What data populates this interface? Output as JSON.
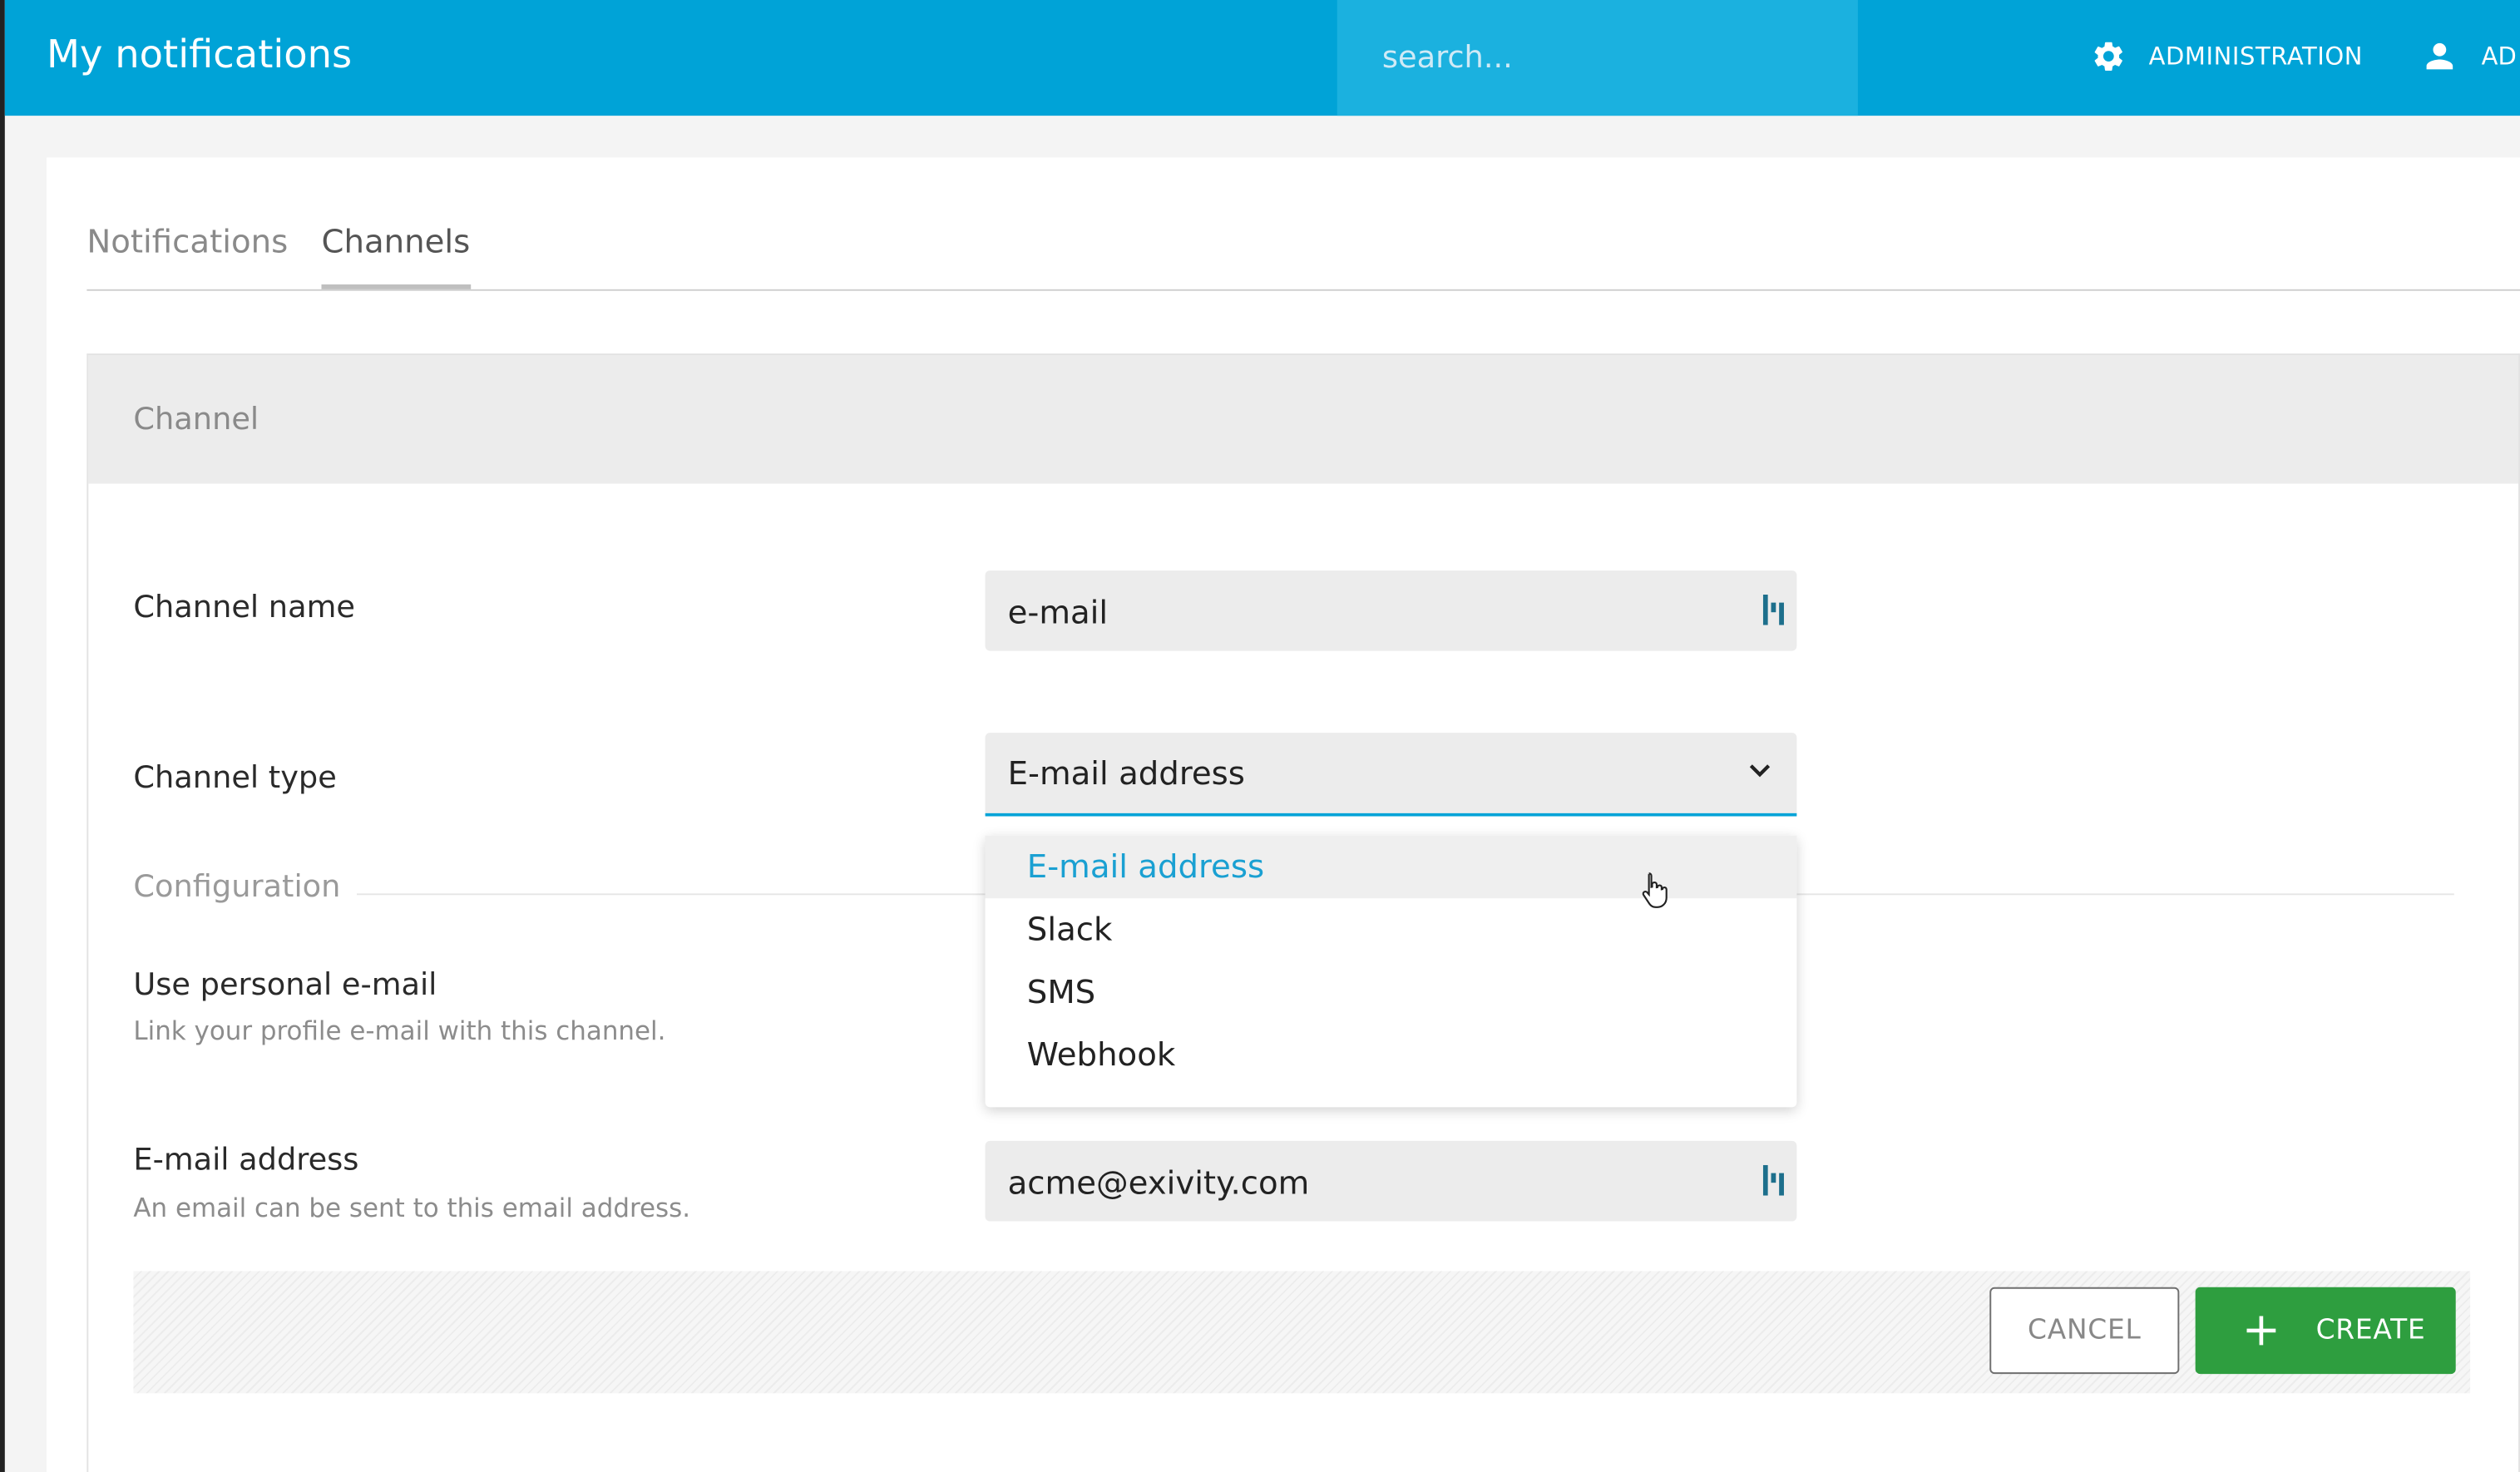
{
  "header": {
    "title": "My notifications",
    "search_placeholder": "search...",
    "admin_label": "ADMINISTRATION",
    "user_label": "AD"
  },
  "tabs": [
    {
      "label": "Notifications",
      "active": false
    },
    {
      "label": "Channels",
      "active": true
    }
  ],
  "panel": {
    "title": "Channel",
    "channel_name": {
      "label": "Channel name",
      "value": "e-mail"
    },
    "channel_type": {
      "label": "Channel type",
      "selected": "E-mail address",
      "options": [
        "E-mail address",
        "Slack",
        "SMS",
        "Webhook"
      ]
    },
    "configuration_label": "Configuration",
    "personal_email": {
      "label": "Use personal e-mail",
      "help": "Link your profile e-mail with this channel."
    },
    "email_address": {
      "label": "E-mail address",
      "help": "An email can be sent to this email address.",
      "value": "acme@exivity.com"
    }
  },
  "actions": {
    "cancel_label": "CANCEL",
    "create_label": "CREATE"
  },
  "colors": {
    "brand": "#00a3d7",
    "create": "#2e9e3f",
    "selected_option": "#1aa0d2"
  },
  "icons": {
    "admin": "gear-icon",
    "user": "user-icon",
    "field_action": "key-value-icon",
    "select": "chevron-down-icon",
    "create": "plus-icon"
  }
}
